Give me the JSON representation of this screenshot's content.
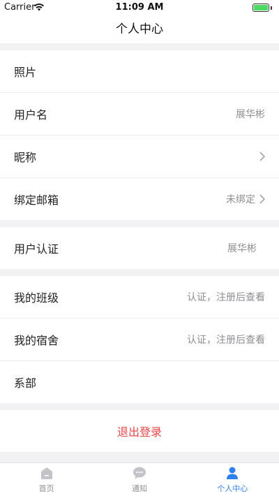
{
  "status_bar": {
    "carrier": "Carrier",
    "time": "11:09 AM",
    "icons": [
      "wifi-icon",
      "battery-icon"
    ]
  },
  "nav": {
    "title": "个人中心"
  },
  "section1": {
    "items": [
      {
        "label": "照片",
        "value": "",
        "has_chevron": false
      },
      {
        "label": "用户名",
        "value": "展华彬",
        "has_chevron": false
      },
      {
        "label": "昵称",
        "value": "",
        "has_chevron": true
      },
      {
        "label": "绑定邮箱",
        "value": "未绑定",
        "has_chevron": true
      }
    ]
  },
  "section2": {
    "items": [
      {
        "label": "用户认证",
        "value": "展华彬",
        "has_chevron": false
      }
    ]
  },
  "section3": {
    "items": [
      {
        "label": "我的班级",
        "value": "认证，注册后查看",
        "has_chevron": false
      },
      {
        "label": "我的宿舍",
        "value": "认证，注册后查看",
        "has_chevron": false
      },
      {
        "label": "系部",
        "value": "",
        "has_chevron": false
      }
    ]
  },
  "logout": {
    "label": "退出登录"
  },
  "tab_bar": {
    "tabs": [
      {
        "label": "首页",
        "icon": "home-icon",
        "active": false
      },
      {
        "label": "通知",
        "icon": "chat-bubble-icon",
        "active": false
      },
      {
        "label": "个人中心",
        "icon": "person-icon",
        "active": true
      }
    ]
  },
  "colors": {
    "accent": "#2e7ff0",
    "logout": "#e84545",
    "background": "#f2f2f4",
    "secondary_text": "#8e8e93"
  }
}
